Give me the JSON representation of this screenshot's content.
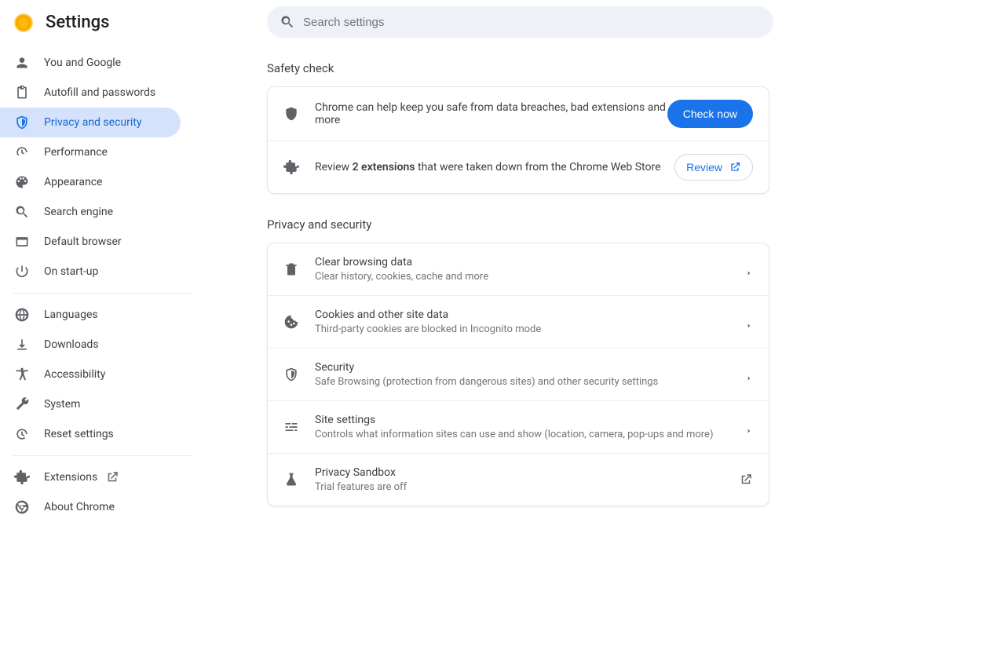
{
  "header": {
    "title": "Settings"
  },
  "search": {
    "placeholder": "Search settings"
  },
  "sidebar": {
    "items": [
      {
        "label": "You and Google",
        "icon": "person"
      },
      {
        "label": "Autofill and passwords",
        "icon": "clipboard"
      },
      {
        "label": "Privacy and security",
        "icon": "shield",
        "active": true
      },
      {
        "label": "Performance",
        "icon": "speed"
      },
      {
        "label": "Appearance",
        "icon": "palette"
      },
      {
        "label": "Search engine",
        "icon": "search"
      },
      {
        "label": "Default browser",
        "icon": "browser"
      },
      {
        "label": "On start-up",
        "icon": "power"
      }
    ],
    "advanced": [
      {
        "label": "Languages",
        "icon": "globe"
      },
      {
        "label": "Downloads",
        "icon": "download"
      },
      {
        "label": "Accessibility",
        "icon": "accessibility"
      },
      {
        "label": "System",
        "icon": "wrench"
      },
      {
        "label": "Reset settings",
        "icon": "restore"
      }
    ],
    "footer": [
      {
        "label": "Extensions",
        "icon": "puzzle",
        "external": true
      },
      {
        "label": "About Chrome",
        "icon": "chrome"
      }
    ]
  },
  "safety": {
    "title": "Safety check",
    "row1_text": "Chrome can help keep you safe from data breaches, bad extensions and more",
    "row1_button": "Check now",
    "row2_prefix": "Review ",
    "row2_bold": "2 extensions",
    "row2_suffix": " that were taken down from the Chrome Web Store",
    "row2_button": "Review"
  },
  "privacy": {
    "title": "Privacy and security",
    "rows": [
      {
        "title": "Clear browsing data",
        "sub": "Clear history, cookies, cache and more",
        "icon": "trash"
      },
      {
        "title": "Cookies and other site data",
        "sub": "Third-party cookies are blocked in Incognito mode",
        "icon": "cookie"
      },
      {
        "title": "Security",
        "sub": "Safe Browsing (protection from dangerous sites) and other security settings",
        "icon": "shield"
      },
      {
        "title": "Site settings",
        "sub": "Controls what information sites can use and show (location, camera, pop-ups and more)",
        "icon": "sliders"
      },
      {
        "title": "Privacy Sandbox",
        "sub": "Trial features are off",
        "icon": "flask",
        "external": true
      }
    ]
  }
}
